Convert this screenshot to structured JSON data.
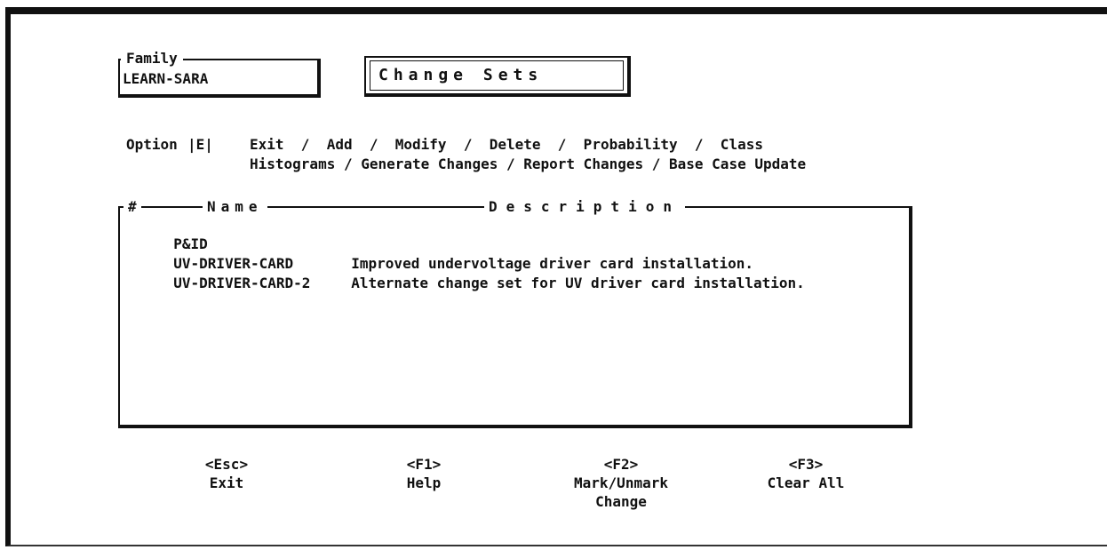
{
  "family": {
    "legend": "Family",
    "value": "LEARN-SARA"
  },
  "title": "Change Sets",
  "option": {
    "label": "Option",
    "key": "|E|",
    "line1": "Exit  /  Add  /  Modify  /  Delete  /  Probability  /  Class",
    "line2": "Histograms / Generate Changes / Report Changes / Base Case Update"
  },
  "list": {
    "headers": {
      "num": "#",
      "name": "Name",
      "description": "Description"
    },
    "rows": [
      {
        "name": "P&ID",
        "description": ""
      },
      {
        "name": "UV-DRIVER-CARD",
        "description": "Improved undervoltage driver card installation."
      },
      {
        "name": "UV-DRIVER-CARD-2",
        "description": "Alternate change set for UV driver card installation."
      }
    ]
  },
  "function_keys": [
    {
      "key": "<Esc>",
      "label": "Exit",
      "label2": ""
    },
    {
      "key": "<F1>",
      "label": "Help",
      "label2": ""
    },
    {
      "key": "<F2>",
      "label": "Mark/Unmark",
      "label2": "Change"
    },
    {
      "key": "<F3>",
      "label": "Clear All",
      "label2": ""
    }
  ]
}
